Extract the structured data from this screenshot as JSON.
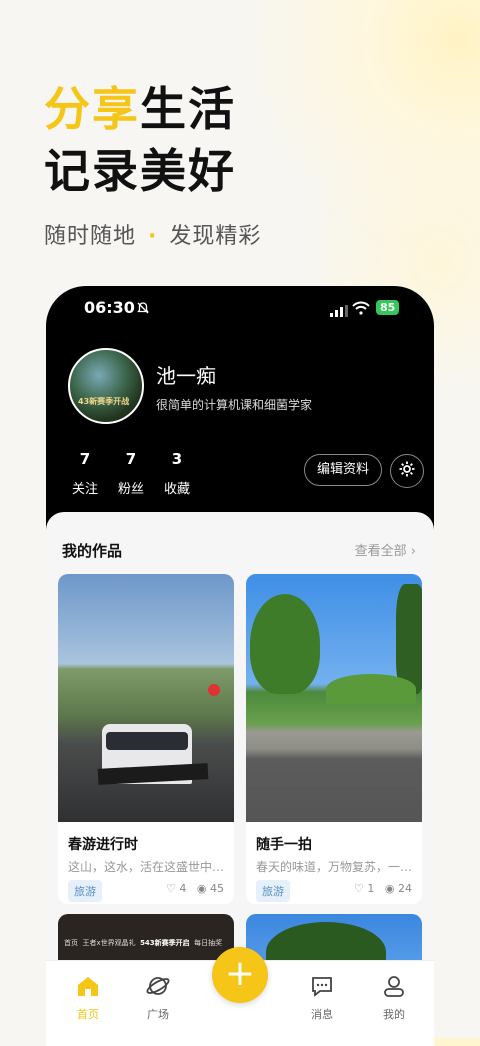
{
  "hero": {
    "line1_accent": "分享",
    "line1_rest": "生活",
    "line2": "记录美好",
    "sub_left": "随时随地",
    "sub_dot": "·",
    "sub_right": "发现精彩"
  },
  "status_bar": {
    "time": "06:30",
    "battery": "85"
  },
  "profile": {
    "name": "池一痴",
    "bio": "很简单的计算机课和细菌学家",
    "avatar_caption": "43新赛季开战",
    "stats": [
      {
        "number": "7",
        "label": "关注"
      },
      {
        "number": "7",
        "label": "粉丝"
      },
      {
        "number": "3",
        "label": "收藏"
      }
    ],
    "edit_label": "编辑资料"
  },
  "works": {
    "title": "我的作品",
    "see_all": "查看全部 ›",
    "items": [
      {
        "title": "春游进行时",
        "desc": "这山，这水，活在这盛世中…",
        "tag": "旅游",
        "likes": "4",
        "views": "45"
      },
      {
        "title": "随手一拍",
        "desc": "春天的味道，万物复苏，一…",
        "tag": "旅游",
        "likes": "1",
        "views": "24"
      }
    ],
    "partial_tabs": [
      "首页",
      "王者x世界观晶礼",
      "543新赛季开启",
      "每日抽奖"
    ]
  },
  "tabbar": {
    "items": [
      {
        "label": "首页",
        "icon": "home-icon"
      },
      {
        "label": "广场",
        "icon": "planet-icon"
      },
      {
        "label": "消息",
        "icon": "message-icon"
      },
      {
        "label": "我的",
        "icon": "user-icon"
      }
    ],
    "fab": "+"
  },
  "colors": {
    "accent": "#f5c518",
    "dark": "#000000",
    "tag_blue": "#5a8fc2"
  }
}
